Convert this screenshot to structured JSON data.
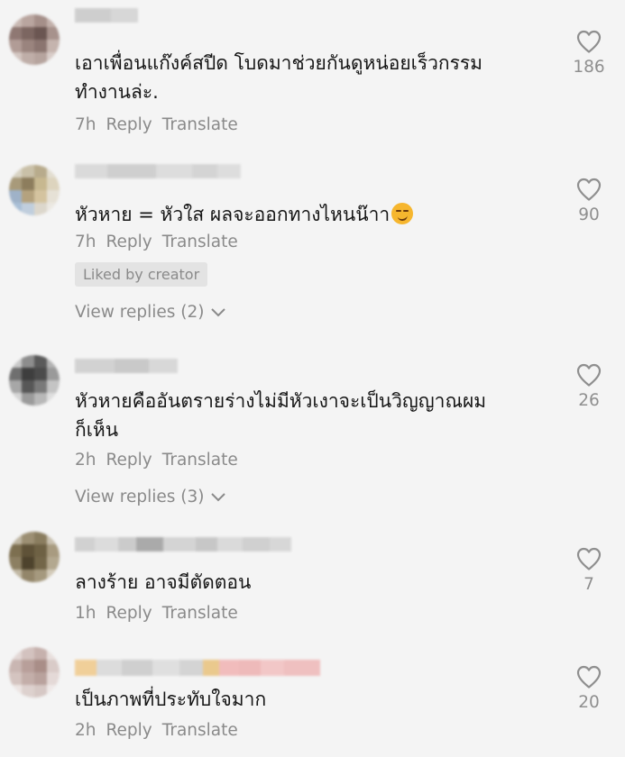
{
  "comments": [
    {
      "text": "เอาเพื่อนแก๊งค์สปีด โบดมาช่วยกันดูหน่อยเร็วกรรม\nทำงานล่ะ.",
      "time": "7h",
      "reply_label": "Reply",
      "translate_label": "Translate",
      "likes": "186"
    },
    {
      "text": "หัวหาย = หัวใส ผลจะออกทางไหนน๊าา",
      "emoji": "smirking-face-emoji",
      "time": "7h",
      "reply_label": "Reply",
      "translate_label": "Translate",
      "liked_by_creator": "Liked by creator",
      "view_replies": "View replies (2)",
      "likes": "90"
    },
    {
      "text": "หัวหายคืออันตรายร่างไม่มีหัวเงาจะเป็นวิญญาณผม\nก็เห็น",
      "time": "2h",
      "reply_label": "Reply",
      "translate_label": "Translate",
      "view_replies": "View replies (3)",
      "likes": "26"
    },
    {
      "text": "ลางร้าย อาจมีตัดตอน",
      "time": "1h",
      "reply_label": "Reply",
      "translate_label": "Translate",
      "likes": "7"
    },
    {
      "text": "เป็นภาพที่ประทับใจมาก",
      "time": "2h",
      "reply_label": "Reply",
      "translate_label": "Translate",
      "likes": "20"
    }
  ],
  "icons": {
    "like": "heart-outline-icon",
    "expand": "chevron-down-icon"
  },
  "colors": {
    "background": "#f4f4f4",
    "text": "#161616",
    "secondary": "#8a8a8a",
    "badge_bg": "#e3e3e3"
  }
}
